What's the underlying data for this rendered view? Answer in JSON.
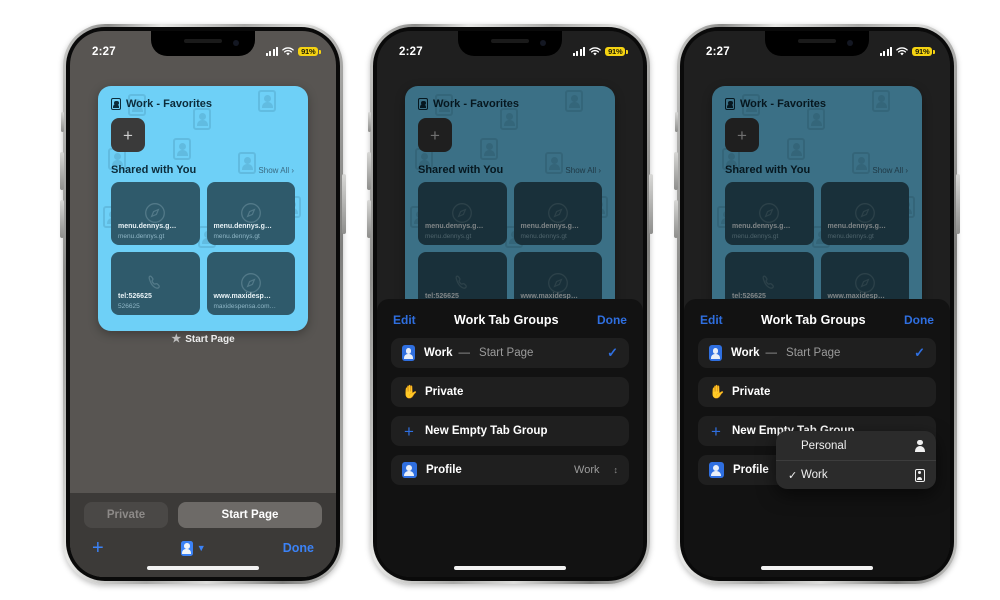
{
  "status_bar": {
    "time": "2:27",
    "battery_text": "91%",
    "battery_color": "#f5d312",
    "signal_icon": "cellular-signal-icon",
    "wifi_icon": "wifi-icon"
  },
  "tab_card": {
    "title": "Work - Favorites",
    "title_icon": "contact-badge-icon",
    "new_tab_icon": "plus-icon",
    "shared_heading": "Shared with You",
    "show_all": "Show All",
    "show_all_chevron": "chevron-right-icon",
    "tiles": [
      {
        "label": "menu.dennys.g…",
        "sub": "menu.dennys.gt",
        "icon": "safari-compass-icon"
      },
      {
        "label": "menu.dennys.g…",
        "sub": "menu.dennys.gt",
        "icon": "safari-compass-icon"
      },
      {
        "label": "tel:526625",
        "sub": "526625",
        "icon": "phone-icon"
      },
      {
        "label": "www.maxidesp…",
        "sub": "maxidespensa.com…",
        "icon": "safari-compass-icon"
      }
    ],
    "caption": "Start Page",
    "caption_icon": "star-icon",
    "accent": "#6ed0f7"
  },
  "toolbar": {
    "private_label": "Private",
    "start_page_label": "Start Page",
    "new_tab_icon": "plus-icon",
    "tab_group_icon": "contact-badge-icon",
    "tab_group_chevron": "chevron-down-icon",
    "done_label": "Done",
    "accent": "#3b82f6"
  },
  "sheet": {
    "edit_label": "Edit",
    "done_label": "Done",
    "title_group": "Work",
    "title_rest": "Tab Groups",
    "rows": [
      {
        "name": "Work",
        "dash": "—",
        "sub": "Start Page",
        "icon": "contact-badge-icon",
        "selected": true,
        "check": "✓"
      },
      {
        "name": "Private",
        "icon": "private-hand-icon",
        "selected": false
      },
      {
        "name": "New Empty Tab Group",
        "icon": "plus-icon",
        "selected": false
      },
      {
        "name": "Profile",
        "icon": "profile-badge-icon",
        "value": "Work",
        "stepper_icon": "up-down-chevron-icon"
      }
    ],
    "accent": "#2f6fe0"
  },
  "context_menu": {
    "items": [
      {
        "label": "Personal",
        "checked": false,
        "tick": "",
        "icon": "person-icon"
      },
      {
        "label": "Work",
        "checked": true,
        "tick": "✓",
        "icon": "contact-badge-icon"
      }
    ]
  },
  "phones": [
    {
      "id": "phone-1",
      "mode": "tab-overview"
    },
    {
      "id": "phone-2",
      "mode": "tab-groups-sheet"
    },
    {
      "id": "phone-3",
      "mode": "tab-groups-sheet-with-menu"
    }
  ]
}
